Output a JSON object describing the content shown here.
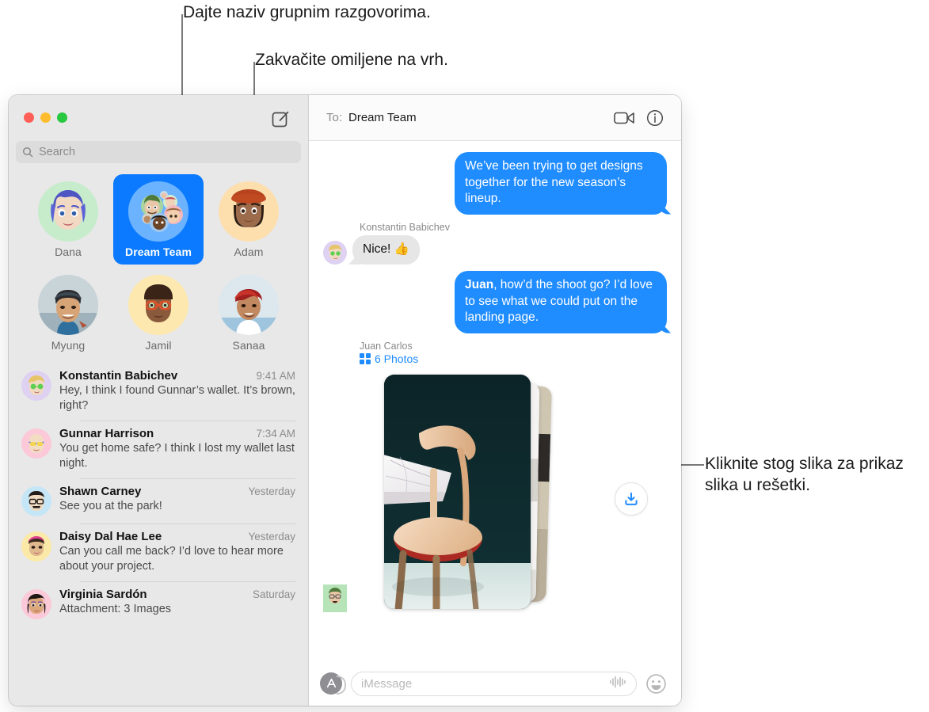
{
  "callouts": [
    {
      "id": "callout-group-name",
      "text": "Dajte naziv grupnim razgovorima."
    },
    {
      "id": "callout-pin-favorites",
      "text": "Zakvačite omiljene na vrh."
    },
    {
      "id": "callout-photo-stack",
      "text": "Kliknite stog slika za prikaz slika u rešetki."
    }
  ],
  "window": {
    "traffic_lights": {
      "close": "close-button",
      "minimize": "minimize-button",
      "zoom": "zoom-button"
    },
    "compose_icon": "compose-icon"
  },
  "sidebar": {
    "search": {
      "placeholder": "Search",
      "value": "",
      "icon": "search-icon"
    },
    "pinned": [
      {
        "name": "Dana",
        "selected": false,
        "avatar": "memoji-dana"
      },
      {
        "name": "Dream Team",
        "selected": true,
        "avatar": "group-memoji-dream-team"
      },
      {
        "name": "Adam",
        "selected": false,
        "avatar": "memoji-adam"
      },
      {
        "name": "Myung",
        "selected": false,
        "avatar": "photo-myung"
      },
      {
        "name": "Jamil",
        "selected": false,
        "avatar": "memoji-jamil"
      },
      {
        "name": "Sanaa",
        "selected": false,
        "avatar": "photo-sanaa"
      }
    ],
    "conversations": [
      {
        "name": "Konstantin Babichev",
        "time": "9:41 AM",
        "preview": "Hey, I think I found Gunnar’s wallet. It’s brown, right?",
        "avatar": "memoji-konstantin"
      },
      {
        "name": "Gunnar Harrison",
        "time": "7:34 AM",
        "preview": "You get home safe? I think I lost my wallet last night.",
        "avatar": "memoji-gunnar"
      },
      {
        "name": "Shawn Carney",
        "time": "Yesterday",
        "preview": "See you at the park!",
        "avatar": "memoji-shawn"
      },
      {
        "name": "Daisy Dal Hae Lee",
        "time": "Yesterday",
        "preview": "Can you call me back? I’d love to hear more about your project.",
        "avatar": "memoji-daisy"
      },
      {
        "name": "Virginia Sardón",
        "time": "Saturday",
        "preview": "Attachment: 3 Images",
        "avatar": "memoji-virginia"
      }
    ]
  },
  "chat": {
    "header": {
      "to_label": "To:",
      "to_name": "Dream Team",
      "facetime_icon": "video-camera-icon",
      "info_icon": "info-circle-icon"
    },
    "messages": [
      {
        "kind": "outgoing",
        "text": "We’ve been trying to get designs together for the new season’s lineup."
      },
      {
        "kind": "incoming",
        "sender": "Konstantin Babichev",
        "text": "Nice!  👍",
        "avatar": "memoji-konstantin"
      },
      {
        "kind": "outgoing",
        "bold_prefix": "Juan",
        "text": ", how’d the shoot go? I’d love to see what we could put on the landing page."
      },
      {
        "kind": "photo-stack",
        "sender": "Juan Carlos",
        "count_label": "6 Photos",
        "grid_icon": "photo-grid-icon",
        "download_icon": "download-icon",
        "avatar": "memoji-juan"
      }
    ],
    "input": {
      "apps_icon": "app-store-icon",
      "placeholder": "iMessage",
      "value": "",
      "audio_icon": "audio-waveform-icon",
      "emoji_icon": "emoji-smiley-icon"
    }
  },
  "colors": {
    "accent_blue": "#1f8cff",
    "pin_blue": "#0b7aff",
    "sidebar_bg": "#e8e8e8",
    "gray_bubble": "#e6e6e6",
    "traffic_red": "#ff5f57",
    "traffic_yellow": "#febc2e",
    "traffic_green": "#28c840"
  }
}
